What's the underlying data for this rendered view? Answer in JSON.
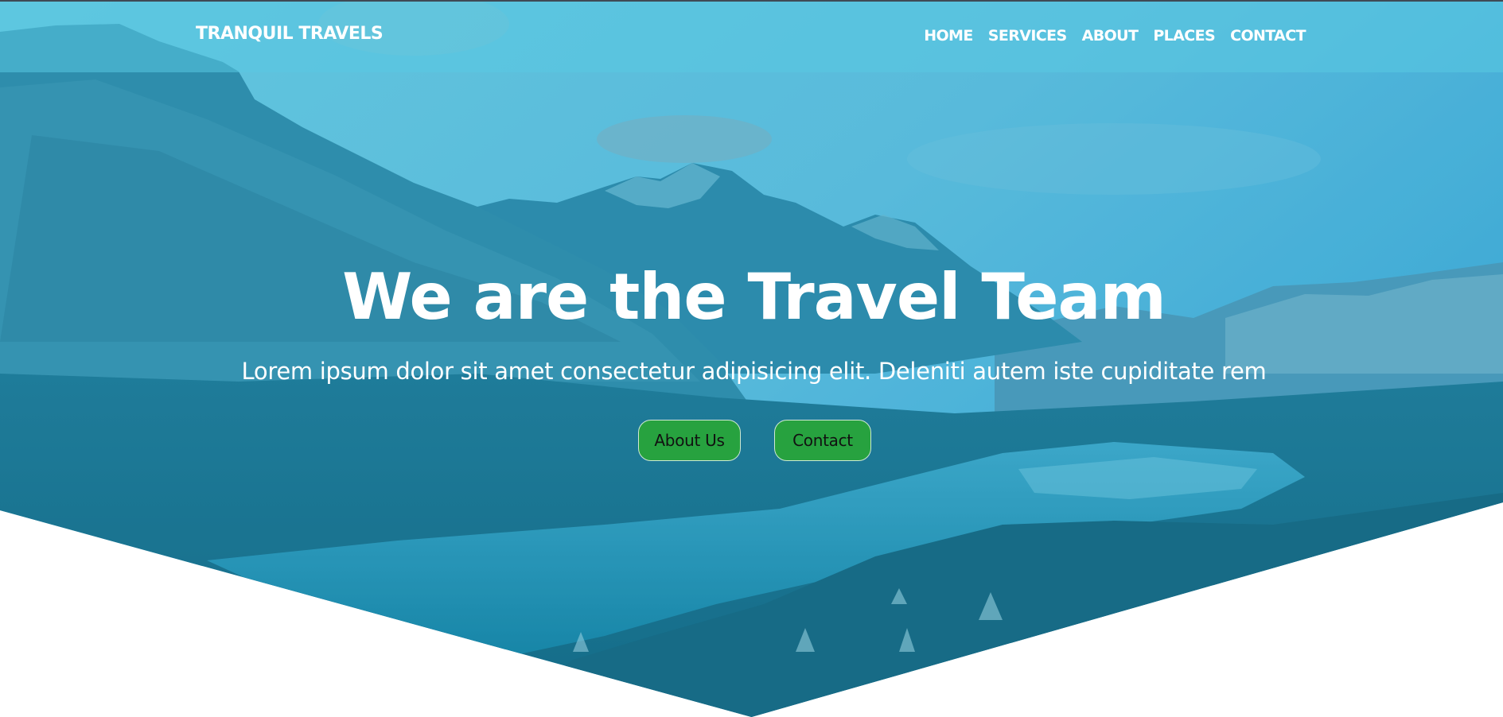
{
  "brand": {
    "name": "TRANQUIL TRAVELS"
  },
  "nav": {
    "items": [
      "HOME",
      "SERVICES",
      "ABOUT",
      "PLACES",
      "CONTACT"
    ]
  },
  "hero": {
    "title": "We are the Travel Team",
    "subtitle": "Lorem ipsum dolor sit amet consectetur adipisicing elit. Deleniti autem iste cupiditate rem",
    "buttons": {
      "about": "About Us",
      "contact": "Contact"
    },
    "background_image": "mountain-lake-landscape"
  },
  "colors": {
    "overlay_tint": "#2aa6c9",
    "button_green": "#27a23f",
    "text_white": "#ffffff"
  }
}
